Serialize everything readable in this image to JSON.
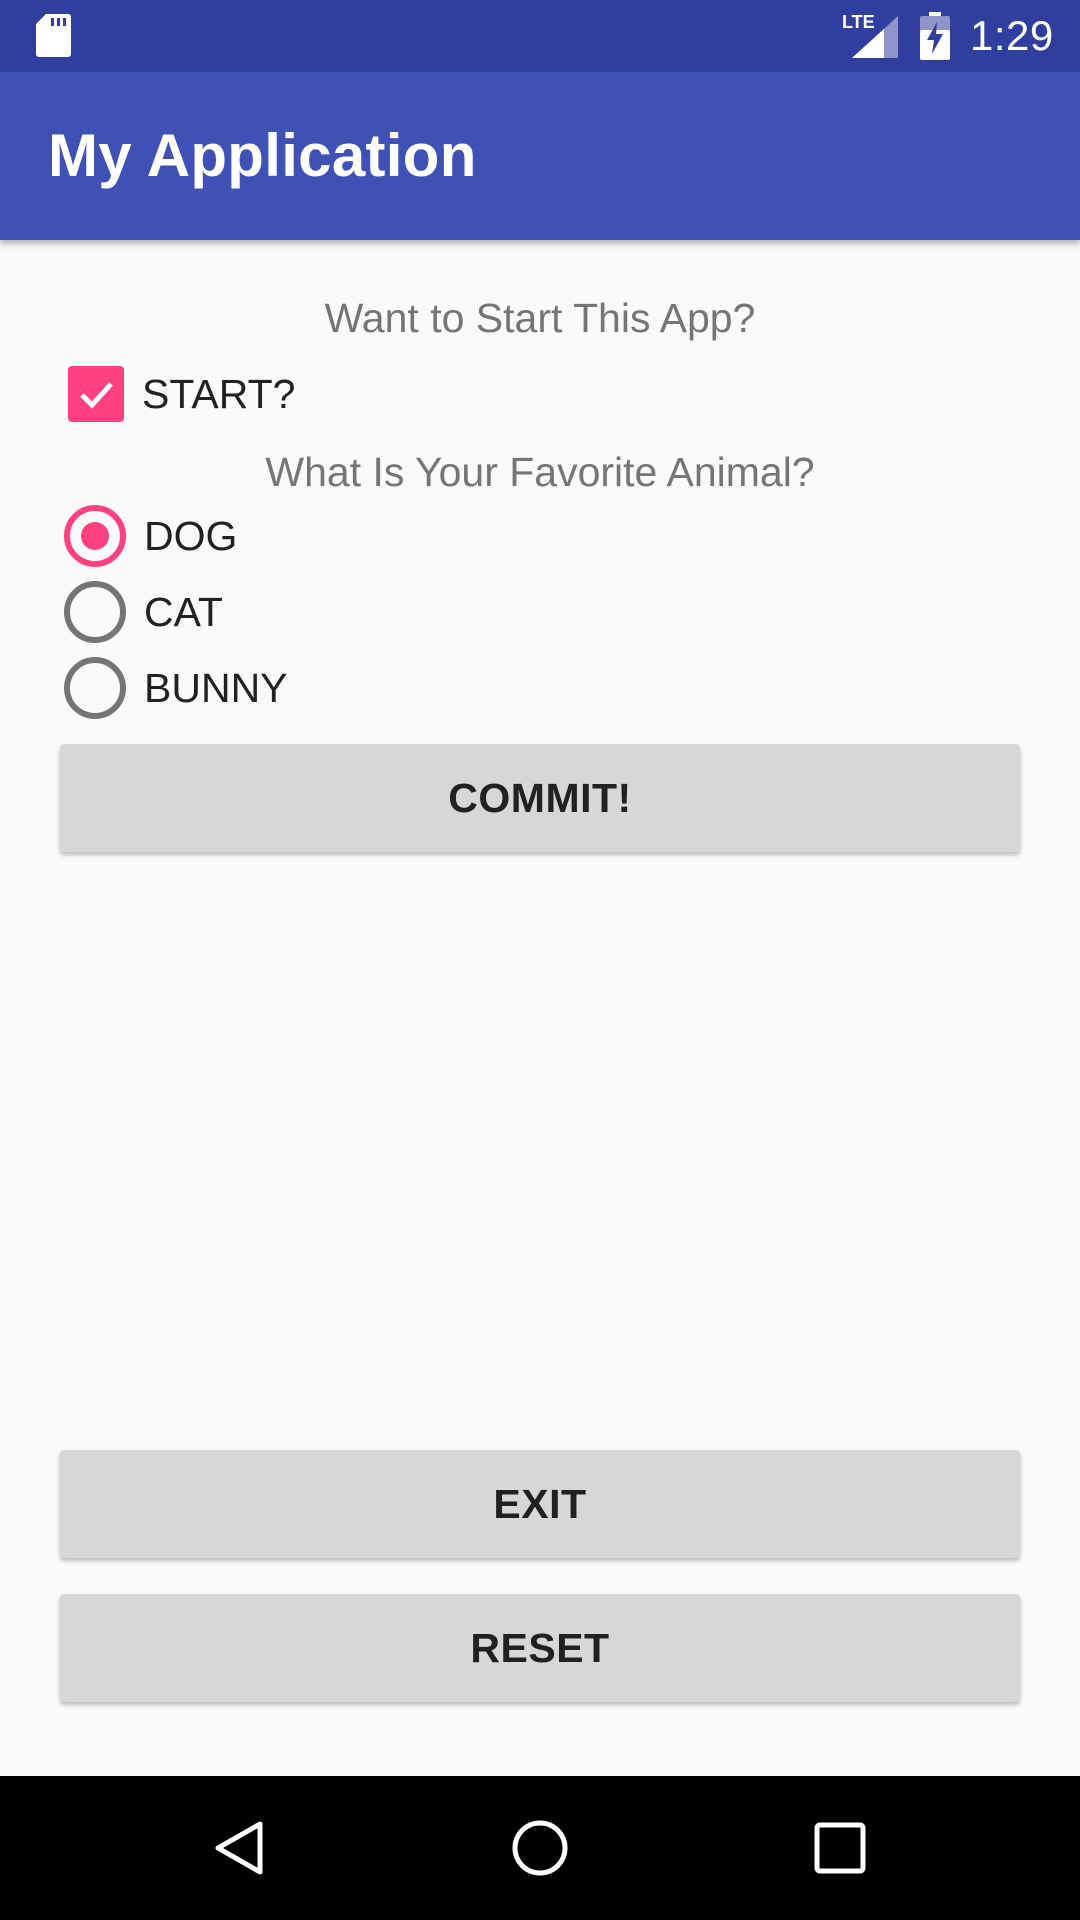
{
  "status_bar": {
    "time": "1:29",
    "network_label": "LTE",
    "icons": [
      "sd-card-icon",
      "lte-signal-icon",
      "battery-charging-icon"
    ]
  },
  "app_bar": {
    "title": "My Application",
    "color": "#3f51b5"
  },
  "form": {
    "start_prompt": "Want to Start This App?",
    "start_checkbox": {
      "label": "START?",
      "checked": true
    },
    "animal_prompt": "What Is Your Favorite Animal?",
    "animal_options": [
      {
        "label": "DOG",
        "selected": true
      },
      {
        "label": "CAT",
        "selected": false
      },
      {
        "label": "BUNNY",
        "selected": false
      }
    ],
    "commit_label": "COMMIT!"
  },
  "actions": {
    "exit_label": "EXIT",
    "reset_label": "RESET"
  },
  "colors": {
    "status_bar": "#303f9f",
    "accent": "#ff4081",
    "button": "#d6d7d7",
    "background": "#fafafa"
  },
  "nav_bar": {
    "icons": [
      "back-icon",
      "home-icon",
      "recents-icon"
    ]
  }
}
